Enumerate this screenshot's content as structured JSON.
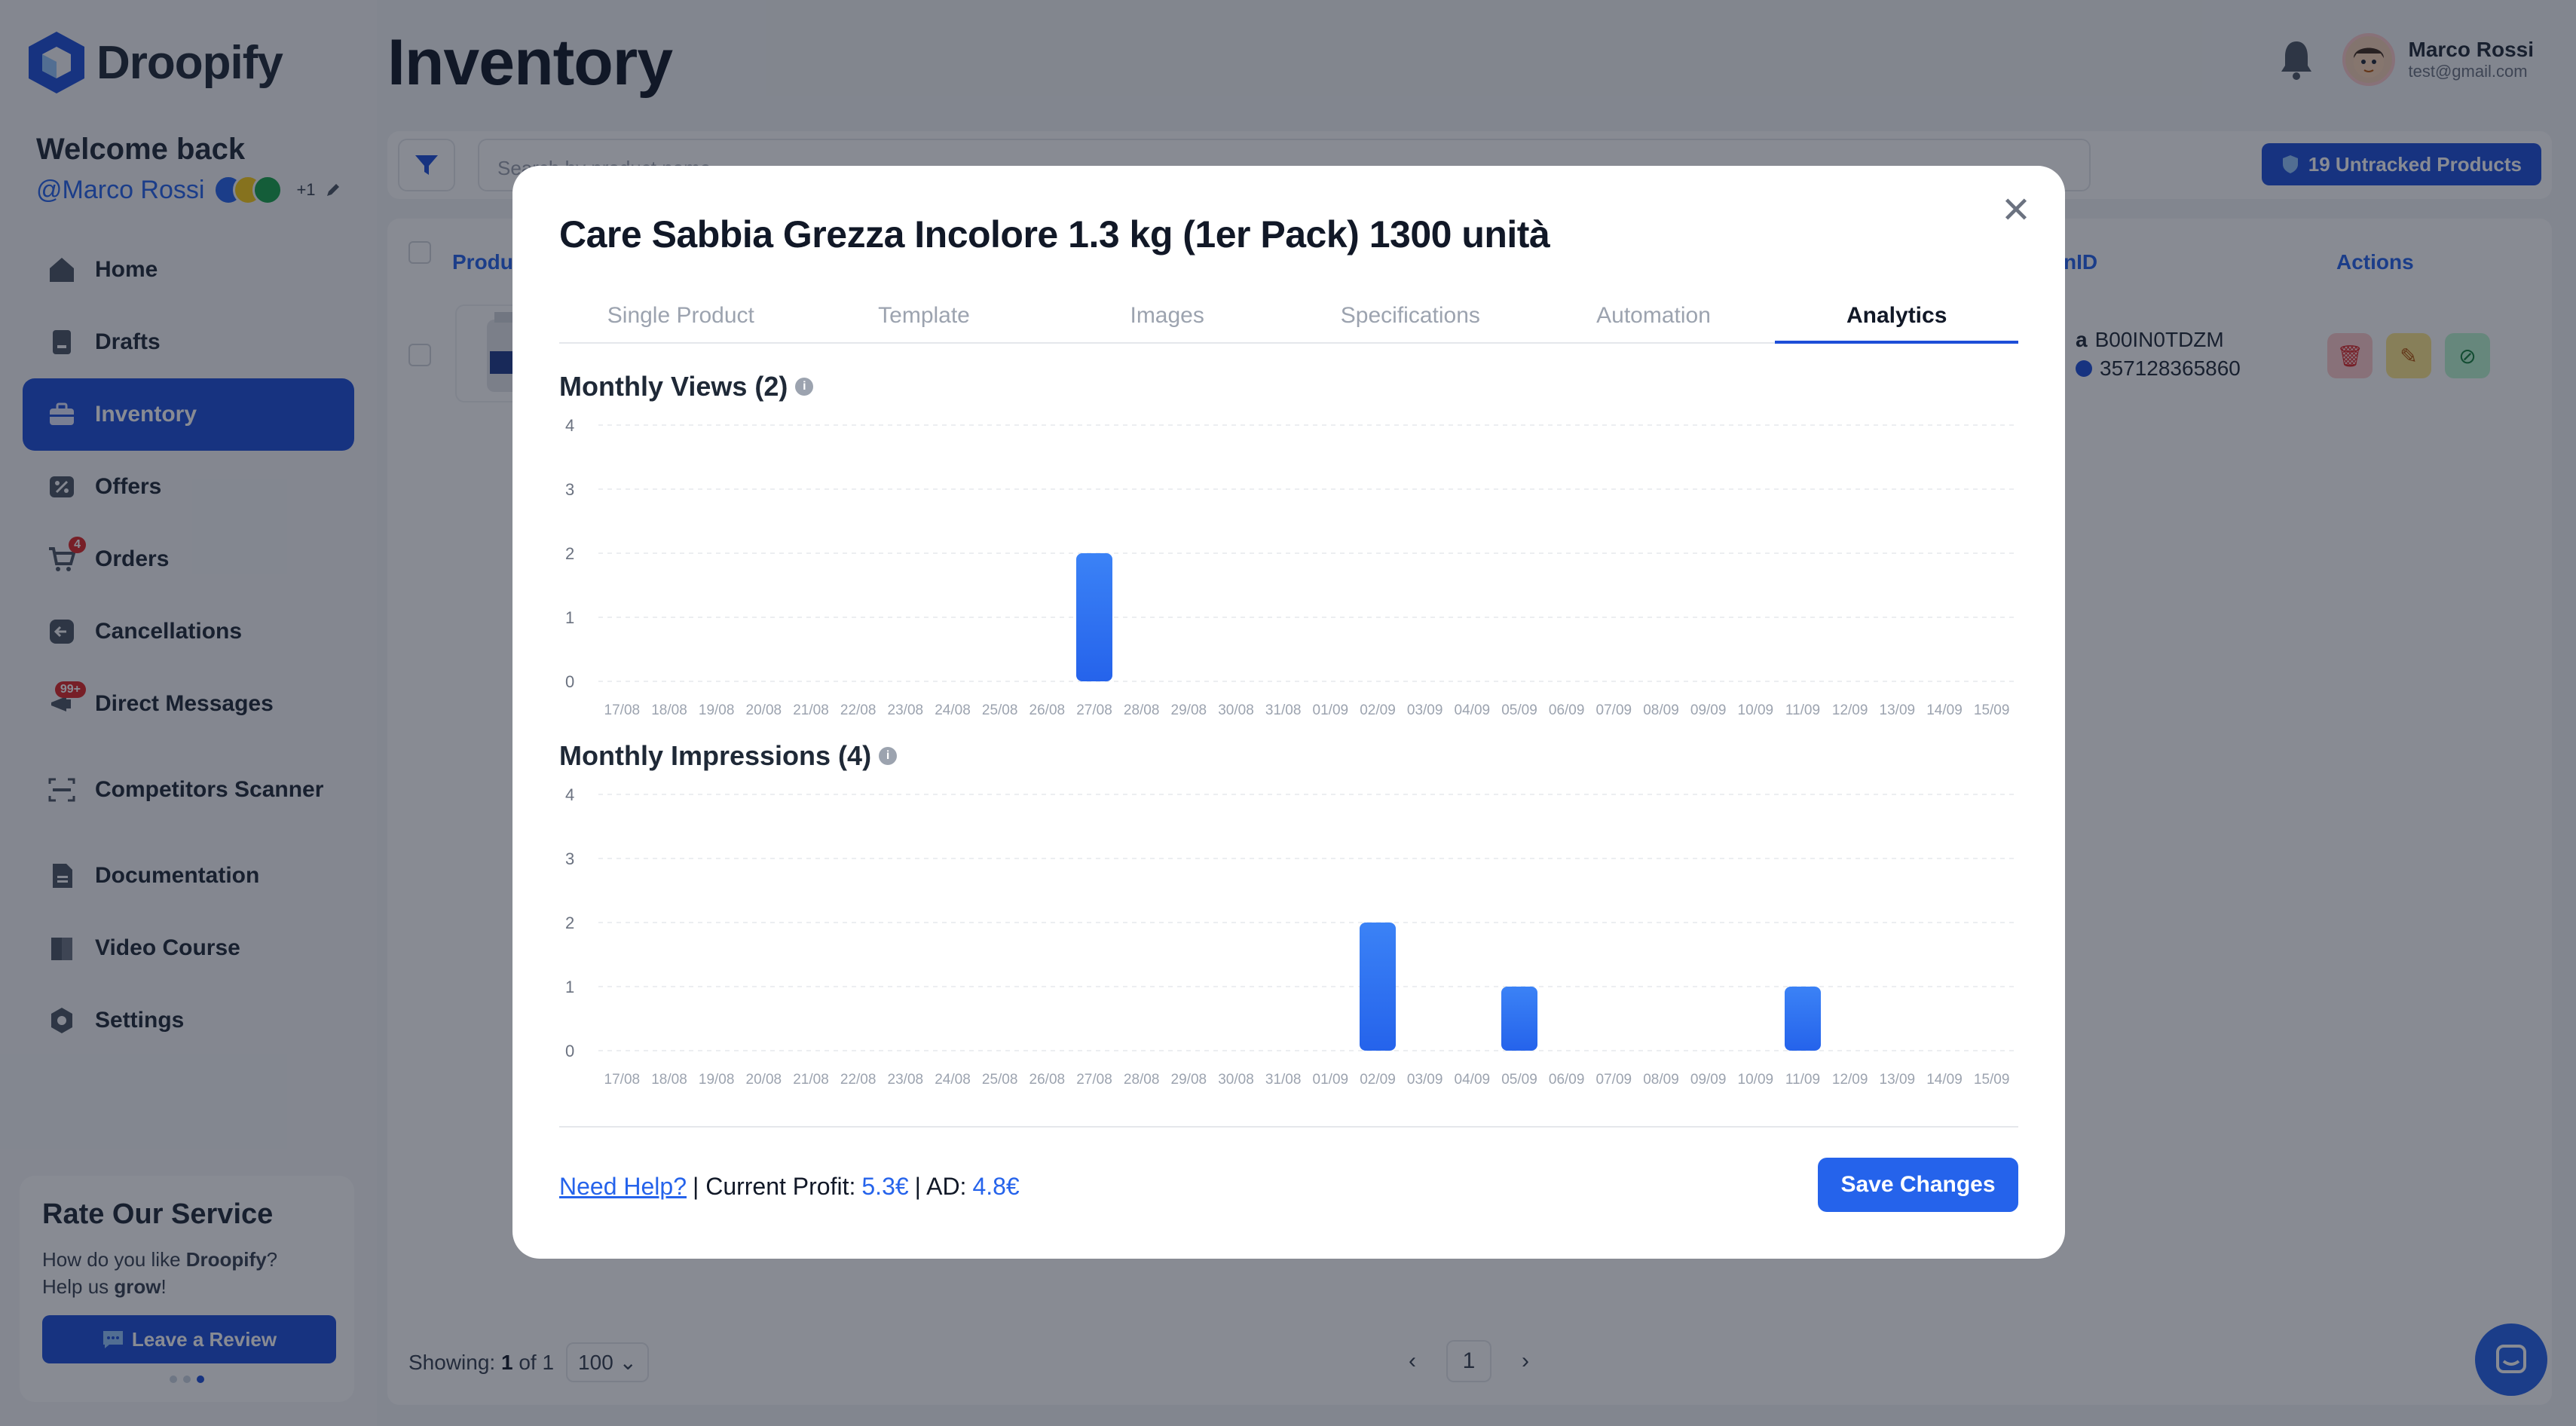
{
  "sidebar": {
    "brand": "Droopify",
    "welcome": "Welcome back",
    "username": "@Marco Rossi",
    "extra_count": "+1",
    "nav": [
      {
        "label": "Home",
        "icon": "home-icon"
      },
      {
        "label": "Drafts",
        "icon": "drafts-icon"
      },
      {
        "label": "Inventory",
        "icon": "inventory-icon",
        "active": true
      },
      {
        "label": "Offers",
        "icon": "offers-icon"
      },
      {
        "label": "Orders",
        "icon": "cart-icon",
        "badge": "4"
      },
      {
        "label": "Cancellations",
        "icon": "cancellations-icon"
      },
      {
        "label": "Direct Messages",
        "icon": "messages-icon",
        "badge": "99+"
      },
      {
        "label": "Competitors Scanner",
        "icon": "scanner-icon"
      },
      {
        "label": "Documentation",
        "icon": "documentation-icon"
      },
      {
        "label": "Video Course",
        "icon": "video-course-icon"
      },
      {
        "label": "Settings",
        "icon": "settings-icon"
      }
    ],
    "rate": {
      "title": "Rate Our Service",
      "text_1": "How do you like ",
      "brand": "Droopify",
      "text_2": "? Help us ",
      "grow": "grow",
      "text_3": "!",
      "button": "Leave a Review"
    }
  },
  "header": {
    "title": "Inventory",
    "user_name": "Marco Rossi",
    "user_email": "test@gmail.com"
  },
  "filterbar": {
    "search_placeholder": "Search by product name",
    "untracked": "19 Untracked Products"
  },
  "table": {
    "columns": {
      "product": "Produc",
      "id": "nID",
      "actions": "Actions"
    },
    "row": {
      "asin": "B00IN0TDZM",
      "ean": "357128365860"
    }
  },
  "pagination": {
    "showing_label": "Showing:",
    "current": "1",
    "of_label": "of",
    "total": "1",
    "per_page": "100",
    "page": "1"
  },
  "modal": {
    "title": "Care Sabbia Grezza Incolore 1.3 kg (1er Pack) 1300 unità",
    "tabs": [
      "Single Product",
      "Template",
      "Images",
      "Specifications",
      "Automation",
      "Analytics"
    ],
    "active_tab": "Analytics",
    "footer": {
      "help": "Need Help?",
      "profit_label": "| Current Profit:",
      "profit": "5.3€",
      "ad_label": "| AD:",
      "ad": "4.8€"
    },
    "save_button": "Save Changes"
  },
  "chart_data": [
    {
      "type": "bar",
      "title": "Monthly Views (2)",
      "categories": [
        "17/08",
        "18/08",
        "19/08",
        "20/08",
        "21/08",
        "22/08",
        "23/08",
        "24/08",
        "25/08",
        "26/08",
        "27/08",
        "28/08",
        "29/08",
        "30/08",
        "31/08",
        "01/09",
        "02/09",
        "03/09",
        "04/09",
        "05/09",
        "06/09",
        "07/09",
        "08/09",
        "09/09",
        "10/09",
        "11/09",
        "12/09",
        "13/09",
        "14/09",
        "15/09"
      ],
      "values": [
        0,
        0,
        0,
        0,
        0,
        0,
        0,
        0,
        0,
        0,
        2,
        0,
        0,
        0,
        0,
        0,
        0,
        0,
        0,
        0,
        0,
        0,
        0,
        0,
        0,
        0,
        0,
        0,
        0,
        0
      ],
      "ylim": [
        0,
        4
      ],
      "yticks": [
        0,
        1,
        2,
        3,
        4
      ],
      "grid": true,
      "color": "#2563eb"
    },
    {
      "type": "bar",
      "title": "Monthly Impressions (4)",
      "categories": [
        "17/08",
        "18/08",
        "19/08",
        "20/08",
        "21/08",
        "22/08",
        "23/08",
        "24/08",
        "25/08",
        "26/08",
        "27/08",
        "28/08",
        "29/08",
        "30/08",
        "31/08",
        "01/09",
        "02/09",
        "03/09",
        "04/09",
        "05/09",
        "06/09",
        "07/09",
        "08/09",
        "09/09",
        "10/09",
        "11/09",
        "12/09",
        "13/09",
        "14/09",
        "15/09"
      ],
      "values": [
        0,
        0,
        0,
        0,
        0,
        0,
        0,
        0,
        0,
        0,
        0,
        0,
        0,
        0,
        0,
        0,
        2,
        0,
        0,
        1,
        0,
        0,
        0,
        0,
        0,
        1,
        0,
        0,
        0,
        0
      ],
      "ylim": [
        0,
        4
      ],
      "yticks": [
        0,
        1,
        2,
        3,
        4
      ],
      "grid": true,
      "color": "#2563eb"
    }
  ]
}
